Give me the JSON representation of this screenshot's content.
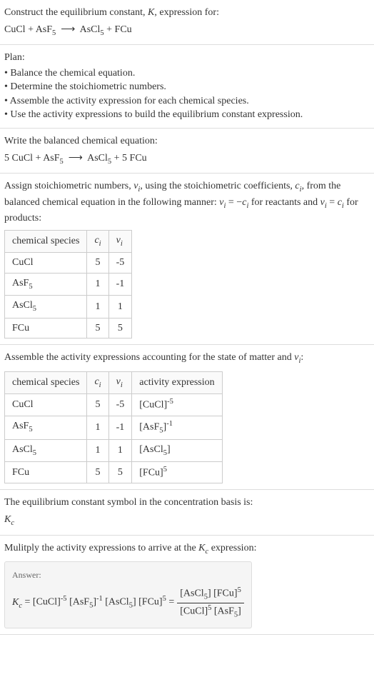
{
  "prompt": {
    "line1": "Construct the equilibrium constant, K, expression for:",
    "equation": "CuCl + AsF₅ ⟶ AsCl₅ + FCu"
  },
  "plan": {
    "title": "Plan:",
    "items": [
      "Balance the chemical equation.",
      "Determine the stoichiometric numbers.",
      "Assemble the activity expression for each chemical species.",
      "Use the activity expressions to build the equilibrium constant expression."
    ]
  },
  "balanced": {
    "title": "Write the balanced chemical equation:",
    "equation": "5 CuCl + AsF₅ ⟶ AsCl₅ + 5 FCu"
  },
  "assign": {
    "text": "Assign stoichiometric numbers, νᵢ, using the stoichiometric coefficients, cᵢ, from the balanced chemical equation in the following manner: νᵢ = −cᵢ for reactants and νᵢ = cᵢ for products:",
    "headers": [
      "chemical species",
      "cᵢ",
      "νᵢ"
    ],
    "rows": [
      {
        "species": "CuCl",
        "c": "5",
        "nu": "-5"
      },
      {
        "species": "AsF₅",
        "c": "1",
        "nu": "-1"
      },
      {
        "species": "AsCl₅",
        "c": "1",
        "nu": "1"
      },
      {
        "species": "FCu",
        "c": "5",
        "nu": "5"
      }
    ]
  },
  "activity": {
    "text": "Assemble the activity expressions accounting for the state of matter and νᵢ:",
    "headers": [
      "chemical species",
      "cᵢ",
      "νᵢ",
      "activity expression"
    ],
    "rows": [
      {
        "species": "CuCl",
        "c": "5",
        "nu": "-5",
        "expr": "[CuCl]⁻⁵"
      },
      {
        "species": "AsF₅",
        "c": "1",
        "nu": "-1",
        "expr": "[AsF₅]⁻¹"
      },
      {
        "species": "AsCl₅",
        "c": "1",
        "nu": "1",
        "expr": "[AsCl₅]"
      },
      {
        "species": "FCu",
        "c": "5",
        "nu": "5",
        "expr": "[FCu]⁵"
      }
    ]
  },
  "symbol": {
    "text": "The equilibrium constant symbol in the concentration basis is:",
    "sym": "K_c"
  },
  "multiply": {
    "text": "Mulitply the activity expressions to arrive at the K_c expression:"
  },
  "answer": {
    "label": "Answer:",
    "lhs": "K_c = [CuCl]⁻⁵ [AsF₅]⁻¹ [AsCl₅] [FCu]⁵ = ",
    "frac_num": "[AsCl₅] [FCu]⁵",
    "frac_den": "[CuCl]⁵ [AsF₅]"
  }
}
